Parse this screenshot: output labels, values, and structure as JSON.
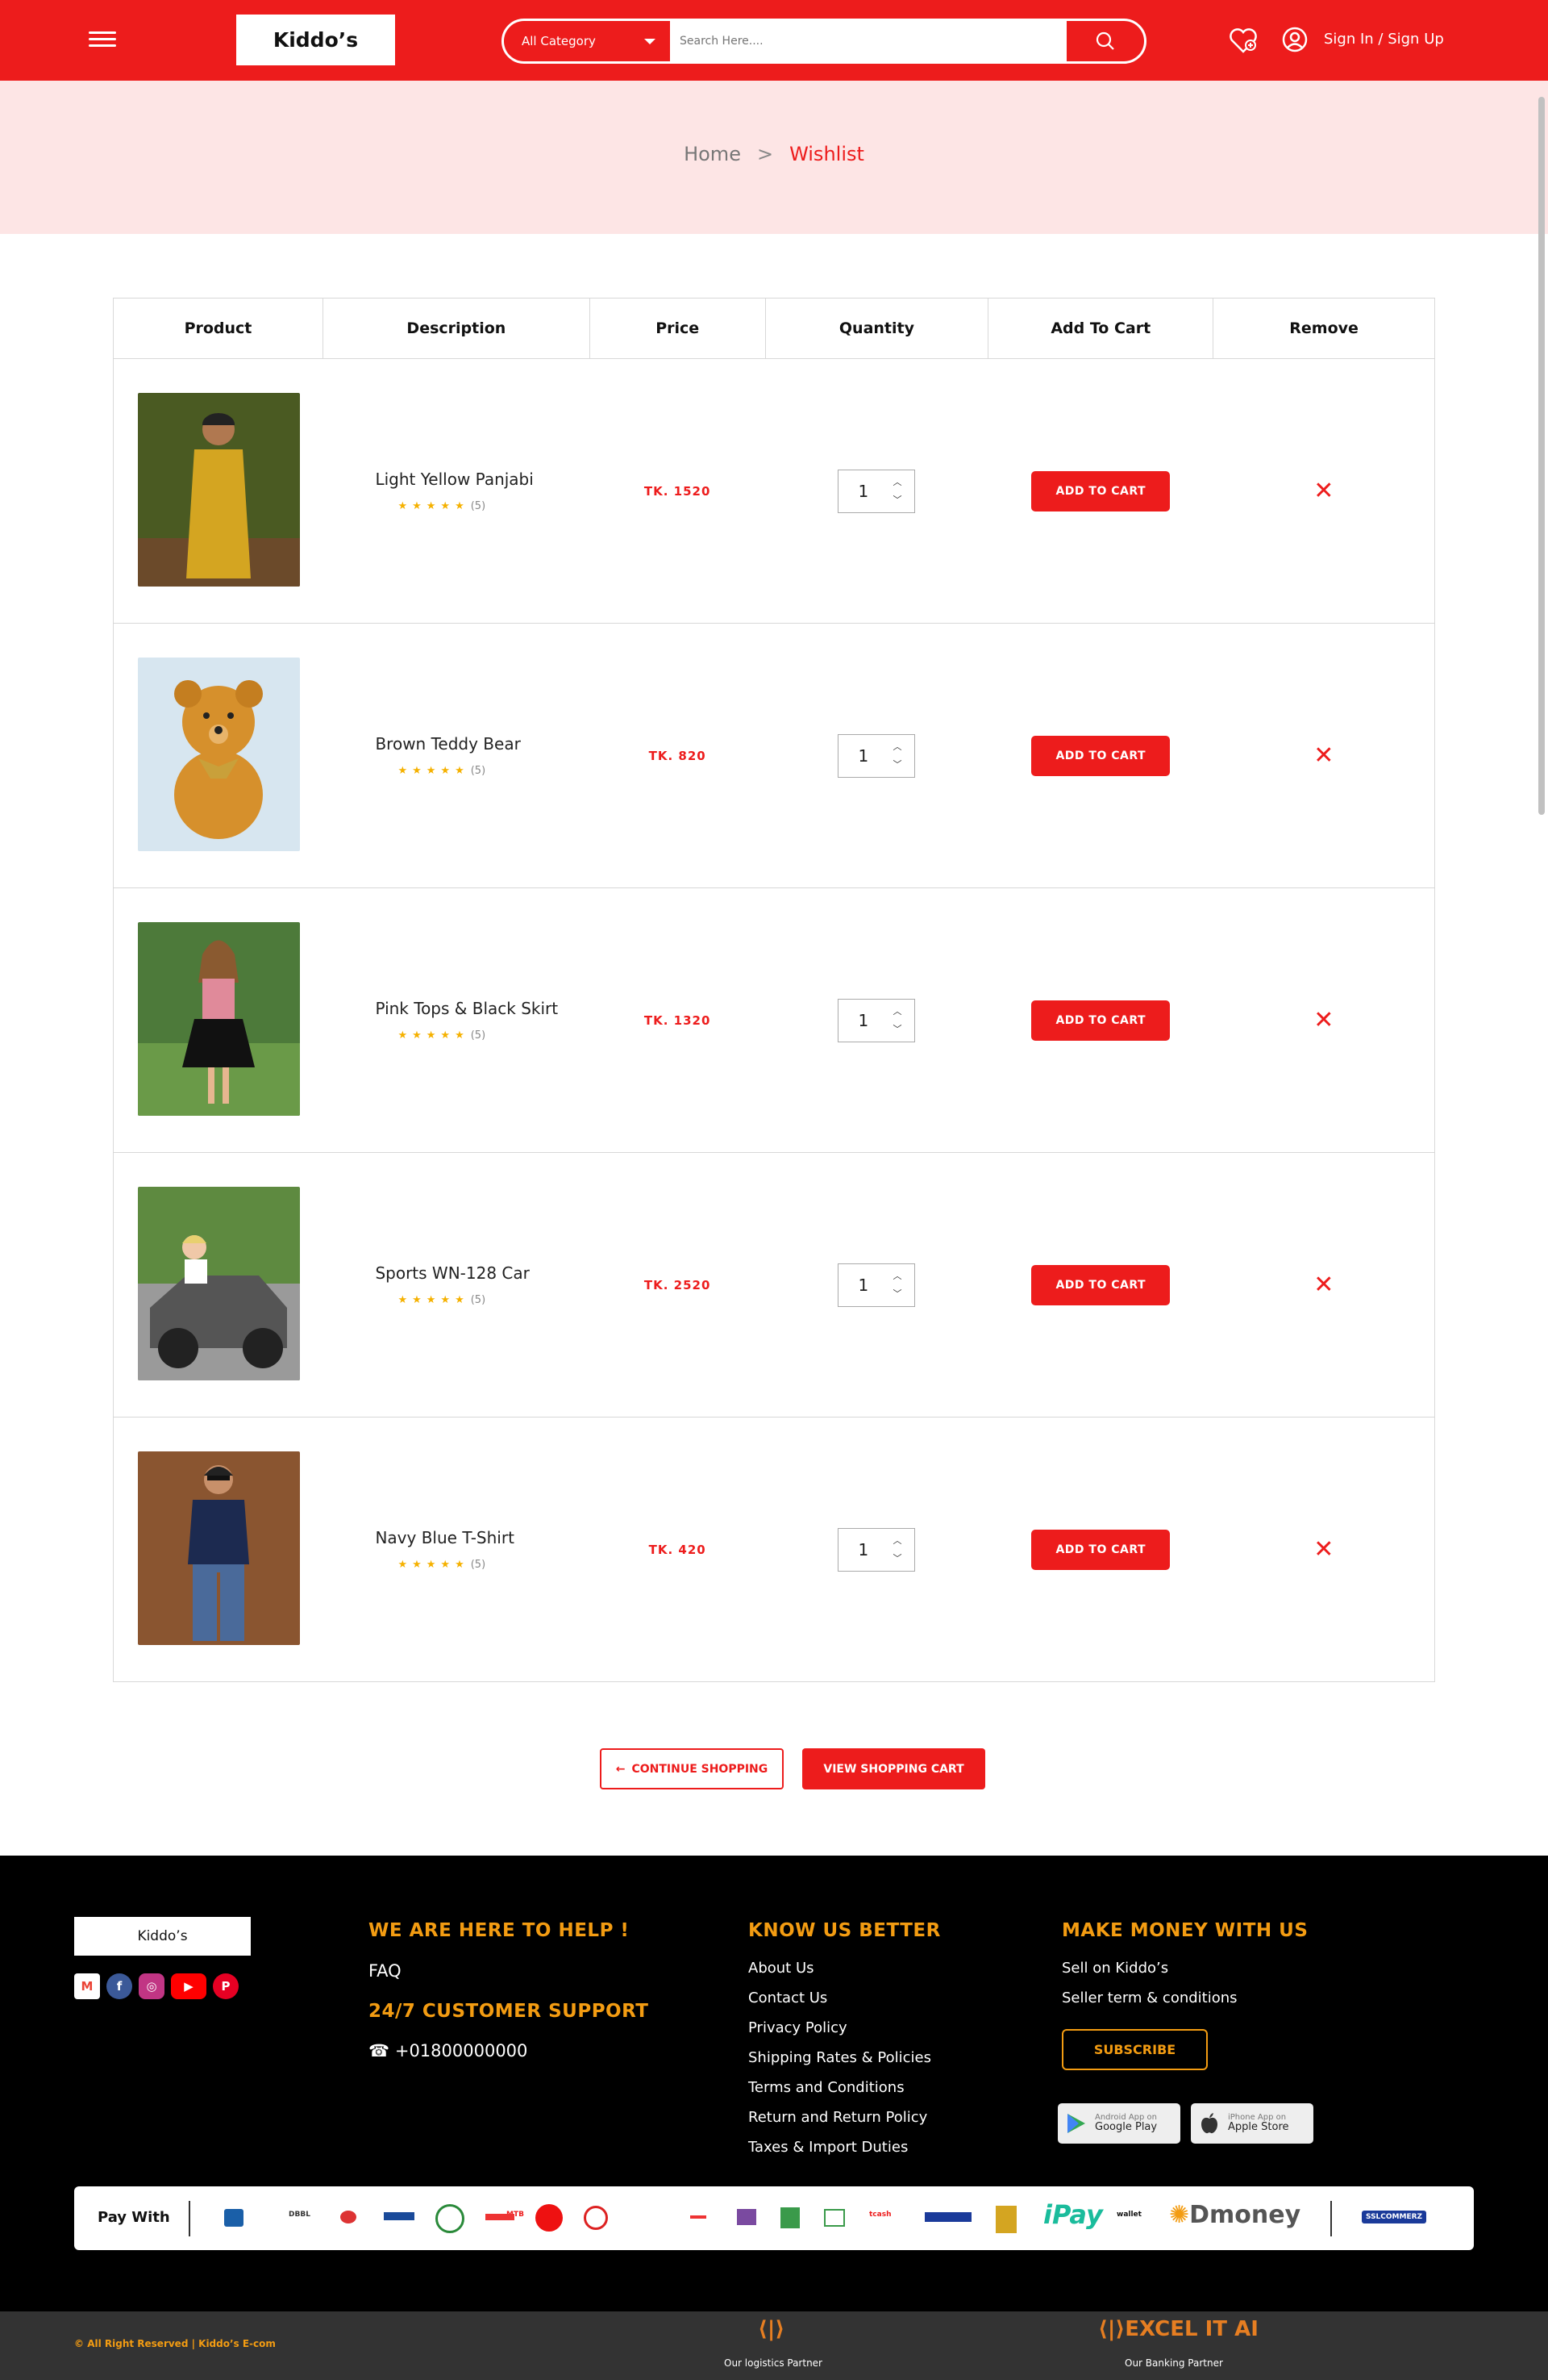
{
  "header": {
    "logo": "Kiddo’s",
    "category": "All Category",
    "search_placeholder": "Search Here....",
    "signin": "Sign In / Sign Up"
  },
  "breadcrumb": {
    "home": "Home",
    "sep": ">",
    "current": "Wishlist"
  },
  "table": {
    "headers": [
      "Product",
      "Description",
      "Price",
      "Quantity",
      "Add To Cart",
      "Remove"
    ],
    "rows": [
      {
        "name": "Light Yellow Panjabi",
        "count": "(5)",
        "price": "TK. 1520",
        "qty": "1",
        "cart": "ADD TO CART",
        "remove": "✕"
      },
      {
        "name": "Brown Teddy Bear",
        "count": "(5)",
        "price": "TK. 820",
        "qty": "1",
        "cart": "ADD TO CART",
        "remove": "✕"
      },
      {
        "name": "Pink Tops & Black Skirt",
        "count": "(5)",
        "price": "TK. 1320",
        "qty": "1",
        "cart": "ADD TO CART",
        "remove": "✕"
      },
      {
        "name": "Sports WN-128 Car",
        "count": "(5)",
        "price": "TK. 2520",
        "qty": "1",
        "cart": "ADD TO CART",
        "remove": "✕"
      },
      {
        "name": "Navy Blue T-Shirt",
        "count": "(5)",
        "price": "TK. 420",
        "qty": "1",
        "cart": "ADD TO CART",
        "remove": "✕"
      }
    ]
  },
  "actions": {
    "continue": "CONTINUE SHOPPING",
    "view_cart": "VIEW SHOPPING CART"
  },
  "footer": {
    "logo": "Kiddo’s",
    "help_title": "WE ARE HERE TO HELP !",
    "faq": "FAQ",
    "support_title": "24/7 CUSTOMER SUPPORT",
    "phone": "+01800000000",
    "know_title": "KNOW US BETTER",
    "know_links": [
      "About Us",
      "Contact Us",
      "Privacy Policy",
      "Shipping Rates & Policies",
      "Terms and Conditions",
      "Return and Return Policy",
      "Taxes & Import Duties"
    ],
    "money_title": "MAKE MONEY WITH US",
    "money_links": [
      "Sell on Kiddo’s",
      "Seller term & conditions"
    ],
    "subscribe": "SUBSCRIBE",
    "google_small": "Android App on",
    "google": "Google Play",
    "apple_small": "iPhone App on",
    "apple": "Apple Store",
    "pay_with": "Pay With",
    "payment_methods": [
      "DBBL",
      "MTB",
      "tcash",
      "iPay",
      "Dmoney",
      "wallet",
      "SSLCOMMERZ"
    ],
    "copyright": "All Right Reserved | Kiddo’s E-com",
    "logistics_partner": "Our logistics Partner",
    "banking_partner": "Our Banking Partner",
    "excel": "EXCEL IT AI"
  },
  "colors": {
    "brand": "#ed1c1c",
    "accent": "#f39c12"
  }
}
